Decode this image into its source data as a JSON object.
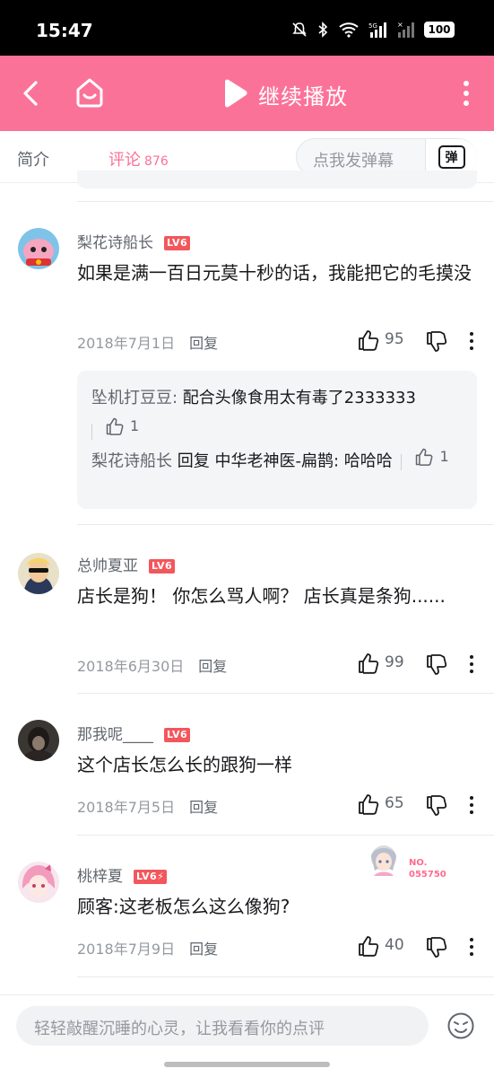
{
  "status_bar": {
    "time": "15:47",
    "battery": "100",
    "network": "5G"
  },
  "header": {
    "title": "继续播放",
    "back_icon": "back-arrow-icon",
    "home_icon": "home-icon",
    "play_icon": "play-icon",
    "more_icon": "more-vertical-icon",
    "background": "#fb7299"
  },
  "tabs": {
    "intro_label": "简介",
    "comments_label": "评论",
    "comments_count": "876",
    "danmaku_placeholder": "点我发弹幕",
    "danmaku_button": "弹"
  },
  "comments": [
    {
      "username": "梨花诗船长",
      "level": "LV6",
      "text": "如果是满一百日元莫十秒的话，我能把它的毛摸没",
      "date": "2018年7月1日",
      "reply_label": "回复",
      "likes": "95",
      "replies": [
        {
          "author": "坠机打豆豆",
          "separator": ": ",
          "body": "配合头像食用太有毒了2333333",
          "likes": "1"
        },
        {
          "author": "梨花诗船长",
          "reply_word": " 回复 ",
          "target": "中华老神医-扁鹊",
          "separator": ": ",
          "body": "哈哈哈",
          "likes": "1"
        }
      ]
    },
    {
      "username": "总帅夏亚",
      "level": "LV6",
      "text": "店长是狗！  你怎么骂人啊？  店长真是条狗......",
      "date": "2018年6月30日",
      "reply_label": "回复",
      "likes": "99"
    },
    {
      "username": "那我呢____",
      "level": "LV6",
      "text": "这个店长怎么长的跟狗一样",
      "date": "2018年7月5日",
      "reply_label": "回复",
      "likes": "65"
    },
    {
      "username": "桃梓夏",
      "level": "LV6⚡",
      "text": "顾客:这老板怎么这么像狗?",
      "date": "2018年7月9日",
      "reply_label": "回复",
      "likes": "40",
      "badge_no": "NO.",
      "badge_num": "055750"
    }
  ],
  "bottom_bar": {
    "placeholder": "轻轻敲醒沉睡的心灵，让我看看你的点评",
    "emoji_icon": "emoji-icon"
  },
  "colors": {
    "accent": "#fb7299",
    "level_badge": "#f2575c",
    "muted_text": "#9499a0"
  }
}
